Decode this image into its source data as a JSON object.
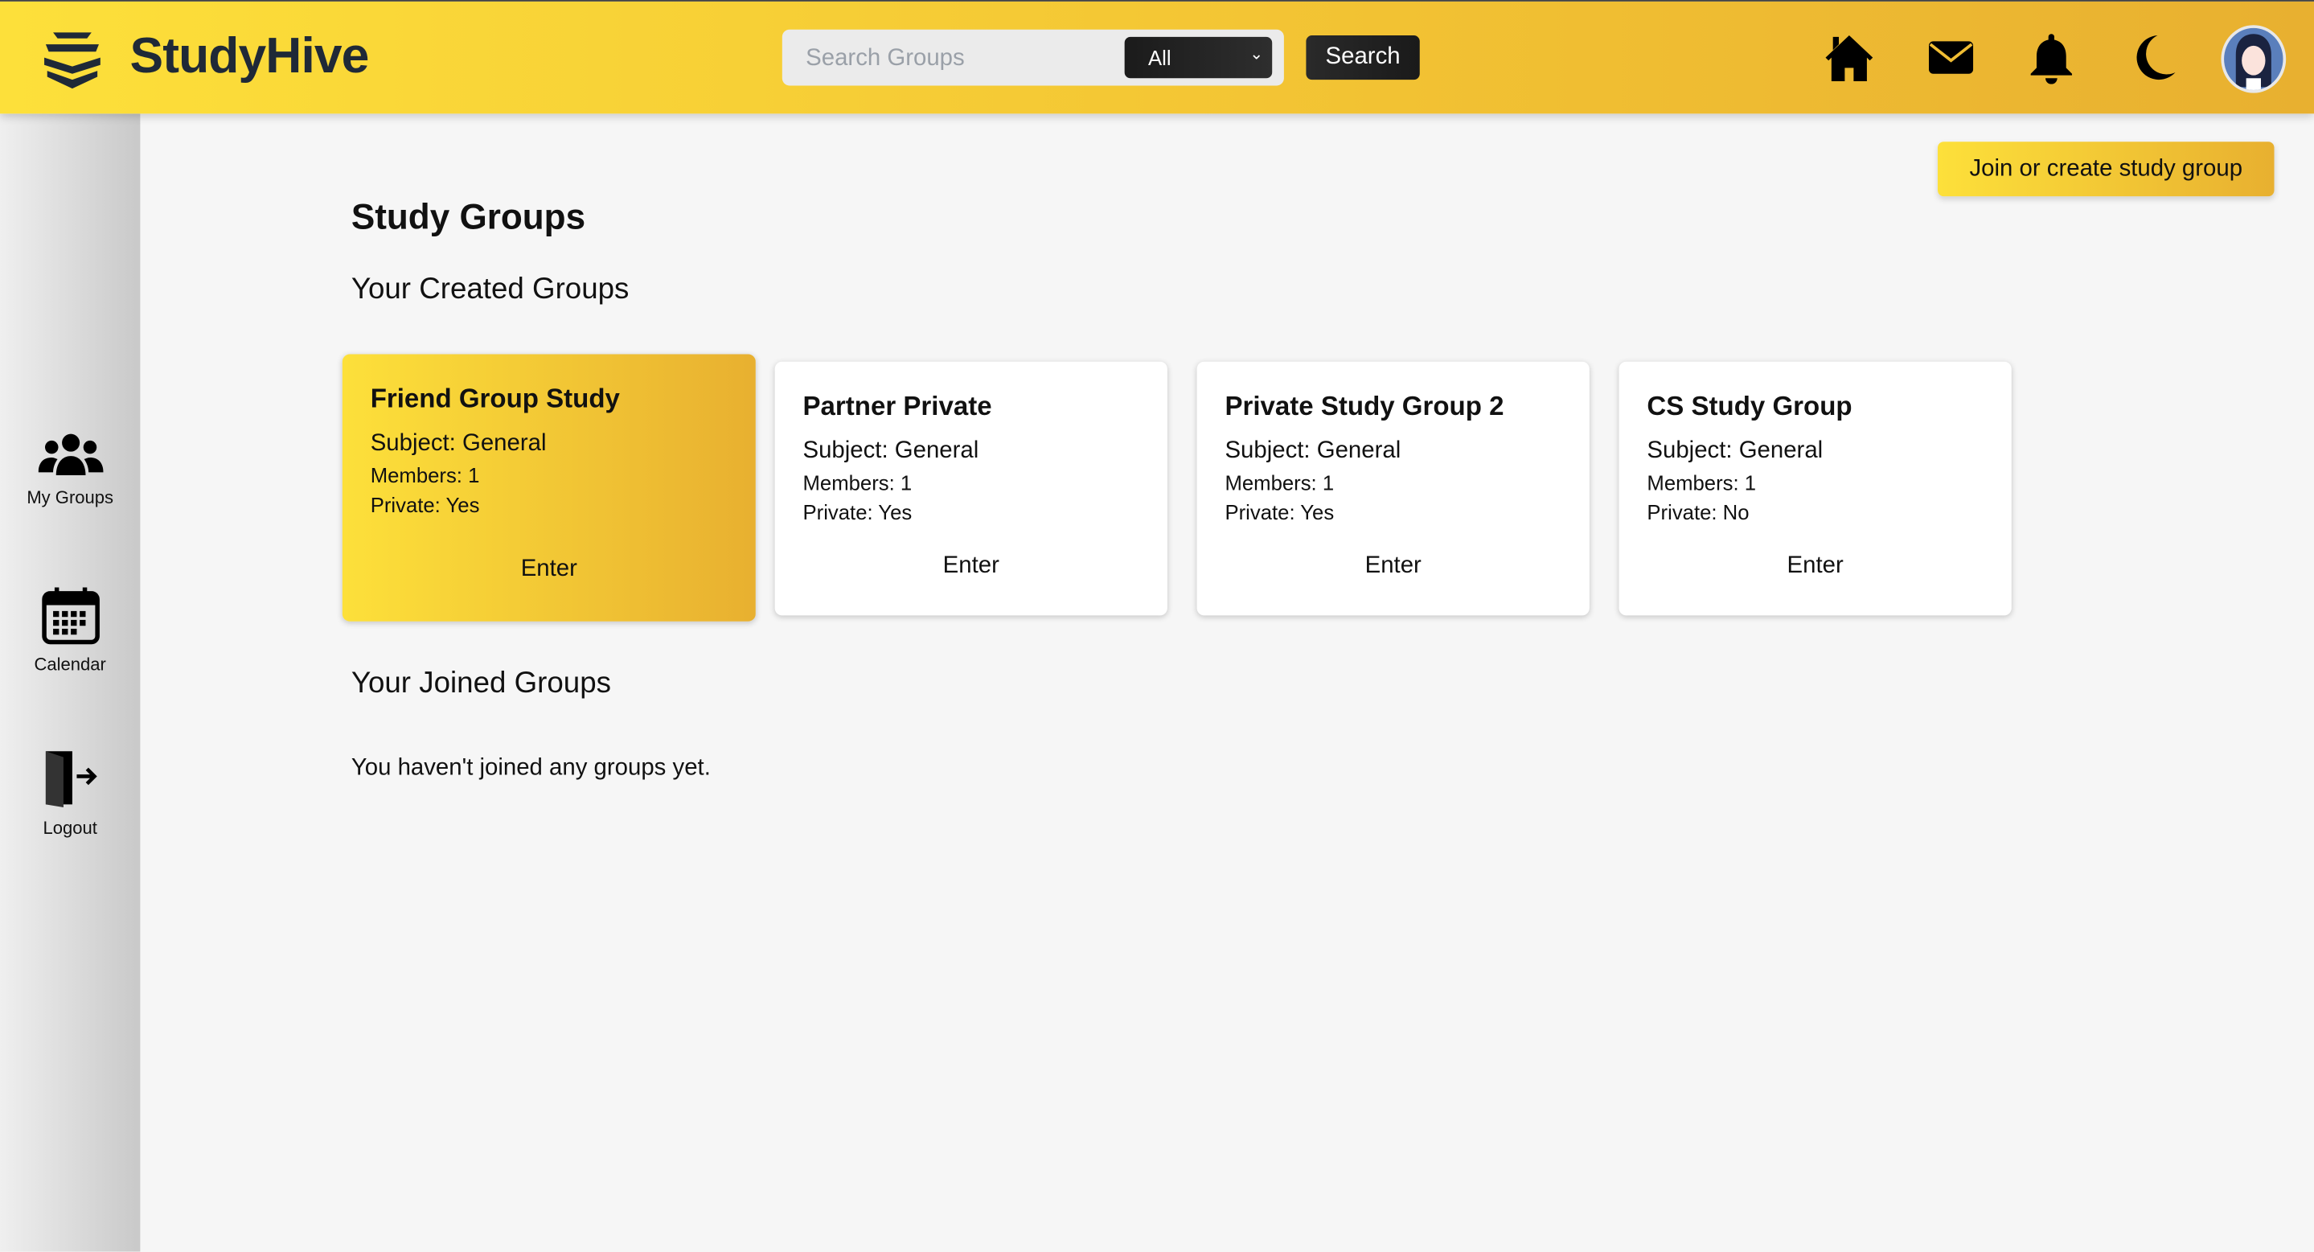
{
  "header": {
    "brand": "StudyHive",
    "search_placeholder": "Search Groups",
    "filter_selected": "All",
    "search_label": "Search"
  },
  "sidebar": {
    "items": [
      {
        "label": "My Groups"
      },
      {
        "label": "Calendar"
      },
      {
        "label": "Logout"
      }
    ]
  },
  "main": {
    "join_button": "Join or create study group",
    "title": "Study Groups",
    "created_heading": "Your Created Groups",
    "created_groups": [
      {
        "name": "Friend Group Study",
        "subject": "Subject: General",
        "members": "Members: 1",
        "private": "Private: Yes",
        "enter": "Enter"
      },
      {
        "name": "Partner Private",
        "subject": "Subject: General",
        "members": "Members: 1",
        "private": "Private: Yes",
        "enter": "Enter"
      },
      {
        "name": "Private Study Group 2",
        "subject": "Subject: General",
        "members": "Members: 1",
        "private": "Private: Yes",
        "enter": "Enter"
      },
      {
        "name": "CS Study Group",
        "subject": "Subject: General",
        "members": "Members: 1",
        "private": "Private: No",
        "enter": "Enter"
      }
    ],
    "joined_heading": "Your Joined Groups",
    "joined_empty": "You haven't joined any groups yet."
  },
  "colors": {
    "accent_start": "#fde03a",
    "accent_end": "#e8b030",
    "dark": "#1f2937"
  }
}
